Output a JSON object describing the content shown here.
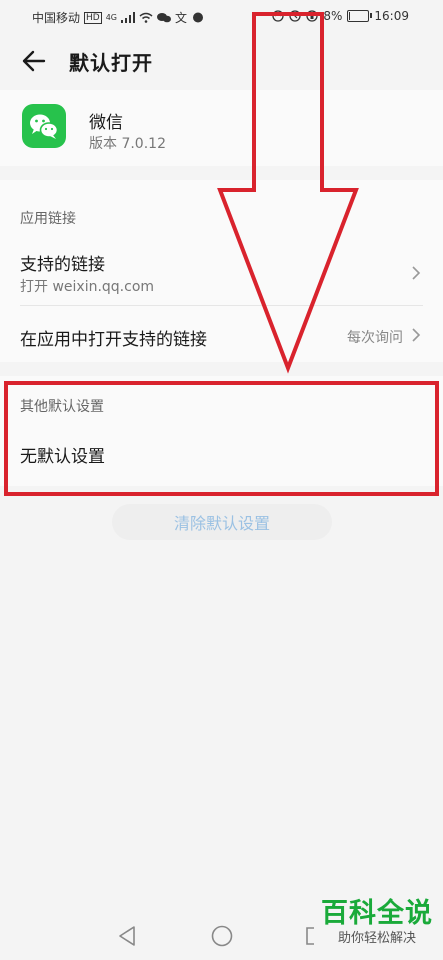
{
  "status_bar": {
    "carrier": "中国移动",
    "hd": "HD",
    "network": "4G",
    "apps": "文",
    "battery_percent": "8%",
    "battery_level": 0.08,
    "time": "16:09"
  },
  "header": {
    "title": "默认打开"
  },
  "app": {
    "name": "微信",
    "version": "版本 7.0.12",
    "icon": "wechat-icon"
  },
  "links_section": {
    "header": "应用链接",
    "supported_links": {
      "title": "支持的链接",
      "subtitle": "打开 weixin.qq.com"
    },
    "open_in_app": {
      "title": "在应用中打开支持的链接",
      "value": "每次询问"
    }
  },
  "other_section": {
    "header": "其他默认设置",
    "value": "无默认设置"
  },
  "clear_button": {
    "label": "清除默认设置"
  },
  "annotation": {
    "arrow_color": "#d9232d",
    "box_color": "#d9232d"
  },
  "watermark": {
    "title": "百科全说",
    "subtitle": "助你轻松解决"
  },
  "colors": {
    "background": "#f4f4f4",
    "card": "#fafafa",
    "wechat_green": "#27c24c",
    "button_text": "#9bc1e3"
  }
}
